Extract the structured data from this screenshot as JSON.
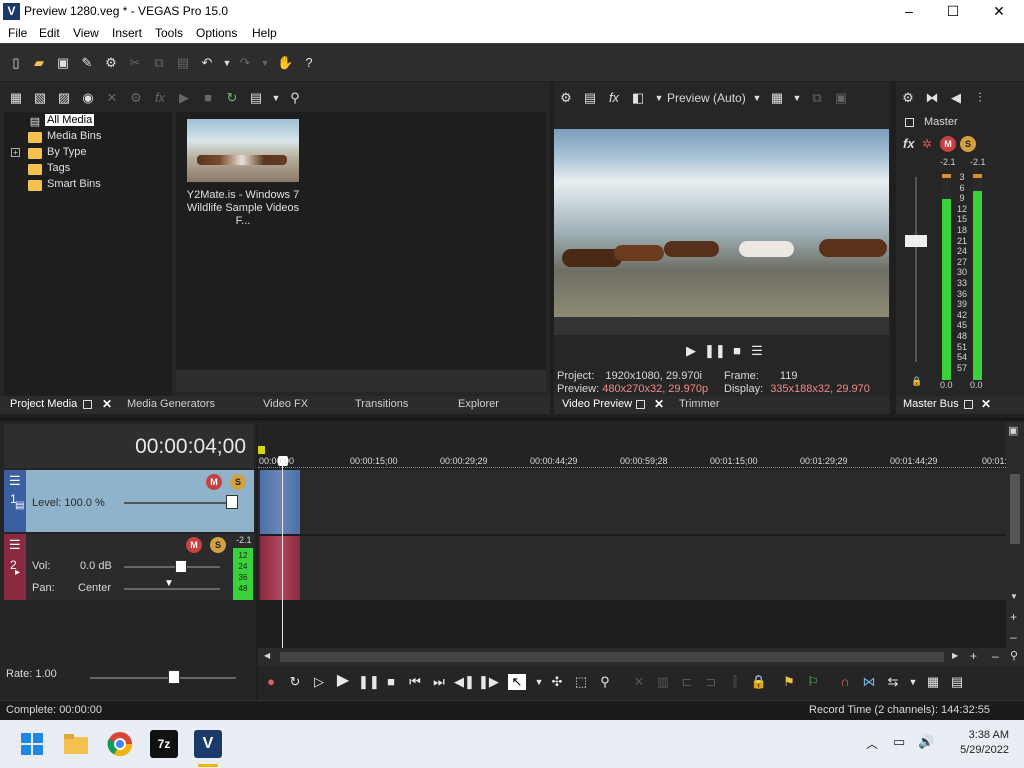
{
  "window": {
    "title": "Preview 1280.veg * - VEGAS Pro 15.0",
    "app_icon_letter": "V",
    "controls": {
      "minimize": "–",
      "maximize": "☐",
      "close": "✕"
    }
  },
  "menu": [
    "File",
    "Edit",
    "View",
    "Insert",
    "Tools",
    "Options",
    "Help"
  ],
  "project_media": {
    "tree": [
      "All Media",
      "Media Bins",
      "By Type",
      "Tags",
      "Smart Bins"
    ],
    "expand_glyph": "+",
    "clip": {
      "name_line1": "Y2Mate.is - Windows 7",
      "name_line2": "Wildlife Sample Videos F..."
    }
  },
  "left_tabs": [
    "Project Media",
    "Media Generators",
    "Video FX",
    "Transitions",
    "Explorer"
  ],
  "preview": {
    "mode": "Preview (Auto)",
    "project_label": "Project:",
    "project_value": "1920x1080, 29.970i",
    "preview_label": "Preview:",
    "preview_value": "480x270x32, 29.970p",
    "frame_label": "Frame:",
    "frame_value": "119",
    "display_label": "Display:",
    "display_value": "335x188x32, 29.970",
    "tabs": [
      "Video Preview",
      "Trimmer"
    ]
  },
  "master": {
    "label": "Master",
    "fx_label": "fx",
    "peak_left": "-2.1",
    "peak_right": "-2.1",
    "scale": [
      "3",
      "6",
      "9",
      "12",
      "15",
      "18",
      "21",
      "24",
      "27",
      "30",
      "33",
      "36",
      "39",
      "42",
      "45",
      "48",
      "51",
      "54",
      "57"
    ],
    "bottom_left": "0.0",
    "bottom_right": "0.0",
    "tab": "Master Bus"
  },
  "timeline": {
    "timecode": "00:00:04;00",
    "ruler": [
      "00:00:00",
      "00:00:15;00",
      "00:00:29;29",
      "00:00:44;29",
      "00:00:59;28",
      "00:01:15;00",
      "00:01:29;29",
      "00:01:44;29",
      "00:01:"
    ],
    "video_track": {
      "number": "1",
      "level_label": "Level: 100.0 %"
    },
    "audio_track": {
      "number": "2",
      "vol_label": "Vol:",
      "vol_value": "0.0 dB",
      "pan_label": "Pan:",
      "pan_value": "Center",
      "peak": "-2.1",
      "meter_scale": [
        "12",
        "24",
        "36",
        "48"
      ]
    },
    "rate_label": "Rate: 1.00"
  },
  "status": {
    "left": "Complete: 00:00:00",
    "right": "Record Time (2 channels): 144:32:55"
  },
  "taskbar": {
    "time": "3:38 AM",
    "date": "5/29/2022",
    "apps": [
      "start",
      "file-explorer",
      "chrome",
      "7zip",
      "vegas"
    ],
    "app_labels": {
      "sevenzip": "7z",
      "vegas": "V"
    }
  },
  "colors": {
    "accent_green": "#38d23a",
    "track_video": "#8fb3cb",
    "track_audio": "#2b2b2b",
    "video_track_bar": "#3b5fa0",
    "audio_track_bar": "#8a2a40",
    "status_bar": "#1b1b1b"
  }
}
